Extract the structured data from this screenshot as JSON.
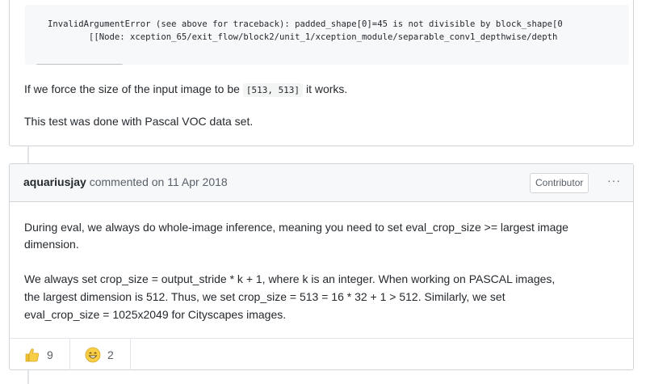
{
  "previous_comment": {
    "code_lines": [
      "InvalidArgumentError (see above for traceback): padded_shape[0]=45 is not divisible by block_shape[0",
      "        [[Node: xception_65/exit_flow/block2/unit_1/xception_module/separable_conv1_depthwise/depth"
    ],
    "para1_before": "If we force the size of the input image to be ",
    "para1_code": "[513, 513]",
    "para1_after": " it works.",
    "para2": "This test was done with Pascal VOC data set."
  },
  "comment": {
    "author": "aquariusjay",
    "action": "commented on 11 Apr 2018",
    "badge": "Contributor",
    "more_icon": "more-horizontal-icon",
    "paragraphs": [
      "During eval, we always do whole-image inference, meaning you need to set eval_crop_size >= largest image",
      "dimension.",
      "We always set crop_size = output_stride * k + 1, where k is an integer. When working on PASCAL images,",
      "the largest dimension is 512. Thus, we set crop_size = 513 = 16 * 32 + 1 > 512. Similarly, we set",
      "eval_crop_size = 1025x2049 for Cityscapes images."
    ],
    "reactions": [
      {
        "icon": "thumbs-up-icon",
        "count": "9"
      },
      {
        "icon": "laugh-icon",
        "count": "2"
      }
    ]
  },
  "colors": {
    "border": "#d1d5da",
    "header_bg": "#f6f8fa",
    "reaction_yellow": "#f7ce45"
  }
}
